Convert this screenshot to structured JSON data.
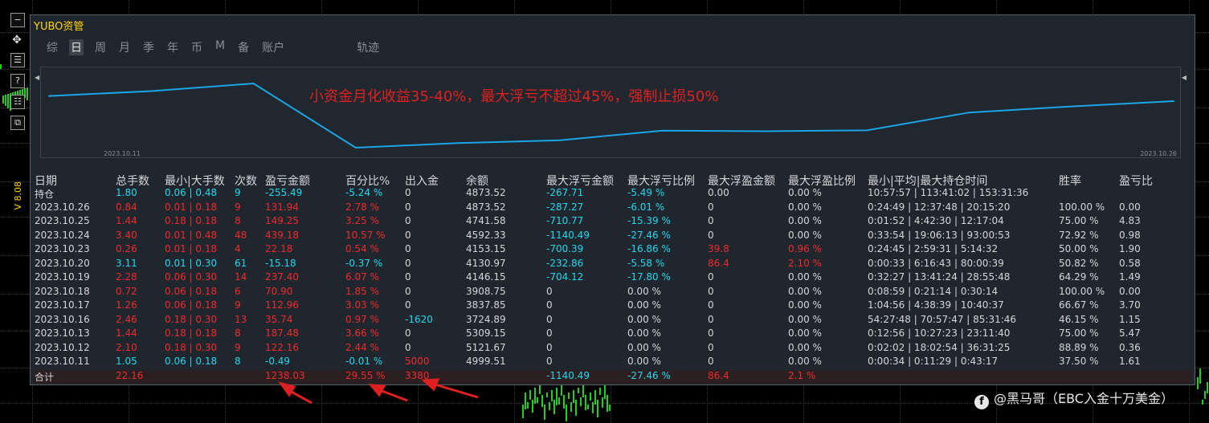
{
  "panel": {
    "title": "YUBO资管"
  },
  "toolbar": {
    "buttons": [
      "−",
      "✥",
      "☰",
      "?",
      "☷",
      "⧉"
    ]
  },
  "side_label": "V 8.08",
  "tabs": [
    {
      "label": "综",
      "active": false
    },
    {
      "label": "日",
      "active": true
    },
    {
      "label": "周",
      "active": false
    },
    {
      "label": "月",
      "active": false
    },
    {
      "label": "季",
      "active": false
    },
    {
      "label": "年",
      "active": false
    },
    {
      "label": "币",
      "active": false
    },
    {
      "label": "M",
      "active": false
    },
    {
      "label": "备",
      "active": false
    },
    {
      "label": "账户",
      "active": false
    },
    {
      "label": "轨迹",
      "active": false
    }
  ],
  "chart_data": {
    "type": "line",
    "annotation": "小资金月化收益35-40%，最大浮亏不超过45%，强制止损50%",
    "x": [
      "2023.10.11",
      "2023.10.12",
      "2023.10.13",
      "2023.10.16",
      "2023.10.17",
      "2023.10.18",
      "2023.10.19",
      "2023.10.20",
      "2023.10.23",
      "2023.10.24",
      "2023.10.25",
      "2023.10.26"
    ],
    "values": [
      4999.51,
      5121.67,
      5309.15,
      3724.89,
      3837.85,
      3908.75,
      4146.15,
      4130.97,
      4153.15,
      4592.33,
      4741.58,
      4873.52
    ],
    "start_label": "2023.10.11",
    "end_label": "2023.10.26",
    "line_color": "#1aa6e6"
  },
  "table": {
    "headers": [
      "日期",
      "总手数",
      "最小|大手数",
      "次数",
      "盈亏金额",
      "百分比%",
      "出入金",
      "余额",
      "最大浮亏金额",
      "最大浮亏比例",
      "最大浮盈金额",
      "最大浮盈比例",
      "最小|平均|最大持仓时间",
      "胜率",
      "盈亏比"
    ],
    "rows": [
      {
        "cells": [
          "持仓",
          "1.80",
          "0.06 | 0.48",
          "9",
          "-255.49",
          "-5.24 %",
          "0",
          "4873.52",
          "-267.71",
          "-5.49 %",
          "0.00",
          "0.00 %",
          "10:57:57 | 113:41:02 | 153:31:36",
          "",
          ""
        ],
        "tone": "neg"
      },
      {
        "cells": [
          "2023.10.26",
          "0.84",
          "0.01 | 0.18",
          "9",
          "131.94",
          "2.78 %",
          "0",
          "4873.52",
          "-287.27",
          "-6.01 %",
          "0",
          "0.00 %",
          "0:24:49 | 12:37:48 | 20:15:20",
          "100.00 %",
          "0.00"
        ],
        "tone": "pos"
      },
      {
        "cells": [
          "2023.10.25",
          "1.44",
          "0.18 | 0.18",
          "8",
          "149.25",
          "3.25 %",
          "0",
          "4741.58",
          "-710.77",
          "-15.39 %",
          "0",
          "0.00 %",
          "0:01:52 | 4:42:30 | 12:17:04",
          "75.00 %",
          "4.83"
        ],
        "tone": "pos"
      },
      {
        "cells": [
          "2023.10.24",
          "3.40",
          "0.01 | 0.48",
          "48",
          "439.18",
          "10.57 %",
          "0",
          "4592.33",
          "-1140.49",
          "-27.46 %",
          "0",
          "0.00 %",
          "0:33:54 | 19:06:13 | 93:00:53",
          "72.92 %",
          "0.98"
        ],
        "tone": "pos"
      },
      {
        "cells": [
          "2023.10.23",
          "0.26",
          "0.01 | 0.18",
          "4",
          "22.18",
          "0.54 %",
          "0",
          "4153.15",
          "-700.39",
          "-16.86 %",
          "39.8",
          "0.96 %",
          "0:24:45 | 2:59:31 | 5:14:32",
          "50.00 %",
          "1.90"
        ],
        "tone": "pos",
        "float_gain": true
      },
      {
        "cells": [
          "2023.10.20",
          "3.11",
          "0.01 | 0.30",
          "61",
          "-15.18",
          "-0.37 %",
          "0",
          "4130.97",
          "-232.86",
          "-5.58 %",
          "86.4",
          "2.10 %",
          "0:00:33 | 6:16:43 | 80:00:39",
          "50.82 %",
          "0.58"
        ],
        "tone": "neg",
        "float_gain": true
      },
      {
        "cells": [
          "2023.10.19",
          "2.28",
          "0.06 | 0.30",
          "14",
          "237.40",
          "6.07 %",
          "0",
          "4146.15",
          "-704.12",
          "-17.80 %",
          "0",
          "0.00 %",
          "0:32:27 | 13:41:24 | 28:55:48",
          "64.29 %",
          "1.49"
        ],
        "tone": "pos"
      },
      {
        "cells": [
          "2023.10.18",
          "0.72",
          "0.06 | 0.18",
          "6",
          "70.90",
          "1.85 %",
          "0",
          "3908.75",
          "0",
          "0.00 %",
          "0",
          "0.00 %",
          "0:08:59 | 0:21:14 | 0:30:14",
          "100.00 %",
          "0.00"
        ],
        "tone": "pos"
      },
      {
        "cells": [
          "2023.10.17",
          "1.26",
          "0.06 | 0.18",
          "9",
          "112.96",
          "3.03 %",
          "0",
          "3837.85",
          "0",
          "0.00 %",
          "0",
          "0.00 %",
          "1:04:56 | 4:38:39 | 10:40:37",
          "66.67 %",
          "3.70"
        ],
        "tone": "pos"
      },
      {
        "cells": [
          "2023.10.16",
          "2.46",
          "0.18 | 0.30",
          "13",
          "35.74",
          "0.97 %",
          "-1620",
          "3724.89",
          "0",
          "0.00 %",
          "0",
          "0.00 %",
          "54:27:48 | 70:57:47 | 85:31:46",
          "46.15 %",
          "1.15"
        ],
        "tone": "pos",
        "flow": "out"
      },
      {
        "cells": [
          "2023.10.13",
          "1.44",
          "0.18 | 0.18",
          "8",
          "187.48",
          "3.66 %",
          "0",
          "5309.15",
          "0",
          "0.00 %",
          "0",
          "0.00 %",
          "0:12:56 | 10:27:23 | 23:11:40",
          "75.00 %",
          "5.47"
        ],
        "tone": "pos"
      },
      {
        "cells": [
          "2023.10.12",
          "2.10",
          "0.18 | 0.30",
          "9",
          "122.16",
          "2.44 %",
          "0",
          "5121.67",
          "0",
          "0.00 %",
          "0",
          "0.00 %",
          "0:02:02 | 18:02:54 | 36:31:25",
          "88.89 %",
          "0.36"
        ],
        "tone": "pos"
      },
      {
        "cells": [
          "2023.10.11",
          "1.05",
          "0.06 | 0.18",
          "8",
          "-0.49",
          "-0.01 %",
          "5000",
          "4999.51",
          "0",
          "0.00 %",
          "0",
          "0.00 %",
          "0:00:34 | 0:11:29 | 0:43:17",
          "37.50 %",
          "1.61"
        ],
        "tone": "neg",
        "flow": "in"
      }
    ],
    "total": {
      "cells": [
        "合计",
        "22.16",
        "",
        "",
        "1238.03",
        "29.55 %",
        "3380",
        "",
        "-1140.49",
        "-27.46 %",
        "86.4",
        "2.1 %",
        "",
        "",
        ""
      ]
    }
  },
  "watermark": {
    "icon": "f",
    "text": "@黑马哥（EBC入金十万美金）"
  },
  "colors": {
    "pos": "#ee2b2b",
    "neg": "#22d8ee",
    "neutral": "#d6d6d6",
    "title": "#ffd700"
  }
}
